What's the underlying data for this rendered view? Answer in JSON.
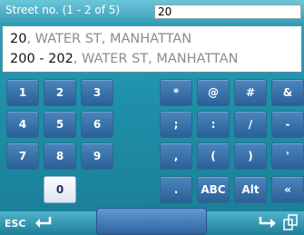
{
  "header": {
    "label": "Street no. (1 - 2 of 5)",
    "input_value": "20"
  },
  "results": [
    {
      "number": "20",
      "rest": ", WATER ST, MANHATTAN"
    },
    {
      "number": "200 - 202",
      "rest": ", WATER ST, MANHATTAN"
    }
  ],
  "keys": {
    "k1": "1",
    "k2": "2",
    "k3": "3",
    "k4": "4",
    "k5": "5",
    "k6": "6",
    "k7": "7",
    "k8": "8",
    "k9": "9",
    "k0": "0",
    "asterisk": "*",
    "at": "@",
    "hash": "#",
    "amp": "&",
    "semicolon": ";",
    "colon": ":",
    "slash": "/",
    "dash": "-",
    "comma": ",",
    "lparen": "(",
    "rparen": ")",
    "quote": "'",
    "period": ".",
    "abc": "ABC",
    "alt": "Alt",
    "left": "«"
  },
  "bottom": {
    "esc_label": "ESC"
  },
  "colors": {
    "key_bg": "#3a73ad",
    "active_key_bg": "#f2f5fa",
    "background": "#1f89a3"
  },
  "icons": [
    "back-arrow-icon",
    "enter-arrow-icon",
    "copy-icon"
  ]
}
